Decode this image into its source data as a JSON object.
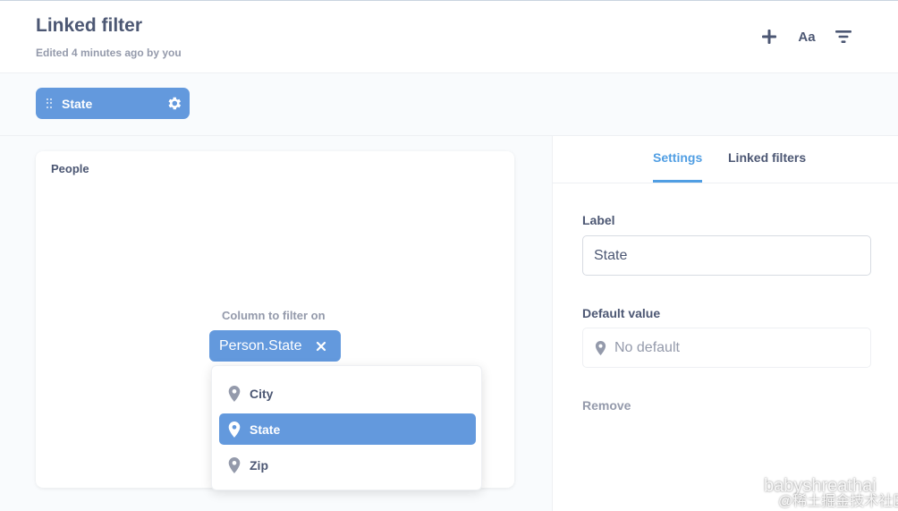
{
  "header": {
    "title": "Linked filter",
    "subtitle": "Edited 4 minutes ago by you",
    "icons": [
      "add-icon",
      "text-format-icon",
      "filter-icon"
    ],
    "text_icon_label": "Aa"
  },
  "filter_bar": {
    "chip_label": "State",
    "chip_icons": [
      "drag-handle-icon",
      "gear-icon"
    ]
  },
  "card": {
    "title": "People",
    "column_label": "Column to filter on",
    "selected_column": "Person.State",
    "dropdown": {
      "items": [
        {
          "label": "City",
          "icon": "location-pin-icon",
          "selected": false
        },
        {
          "label": "State",
          "icon": "location-pin-icon",
          "selected": true
        },
        {
          "label": "Zip",
          "icon": "location-pin-icon",
          "selected": false
        }
      ]
    }
  },
  "sidebar": {
    "tabs": [
      {
        "label": "Settings",
        "active": true
      },
      {
        "label": "Linked filters",
        "active": false
      }
    ],
    "label_field": {
      "label": "Label",
      "value": "State"
    },
    "default_field": {
      "label": "Default value",
      "value": "No default"
    },
    "remove_label": "Remove"
  },
  "watermark": {
    "line1": "babyshreathai",
    "line2": "@稀土掘金技术社区"
  },
  "colors": {
    "accent": "#6399dd",
    "brand": "#509ee3",
    "text_dark": "#4c5773",
    "text_light": "#949aab",
    "border": "#eef0f3",
    "background": "#f9fbfd"
  }
}
